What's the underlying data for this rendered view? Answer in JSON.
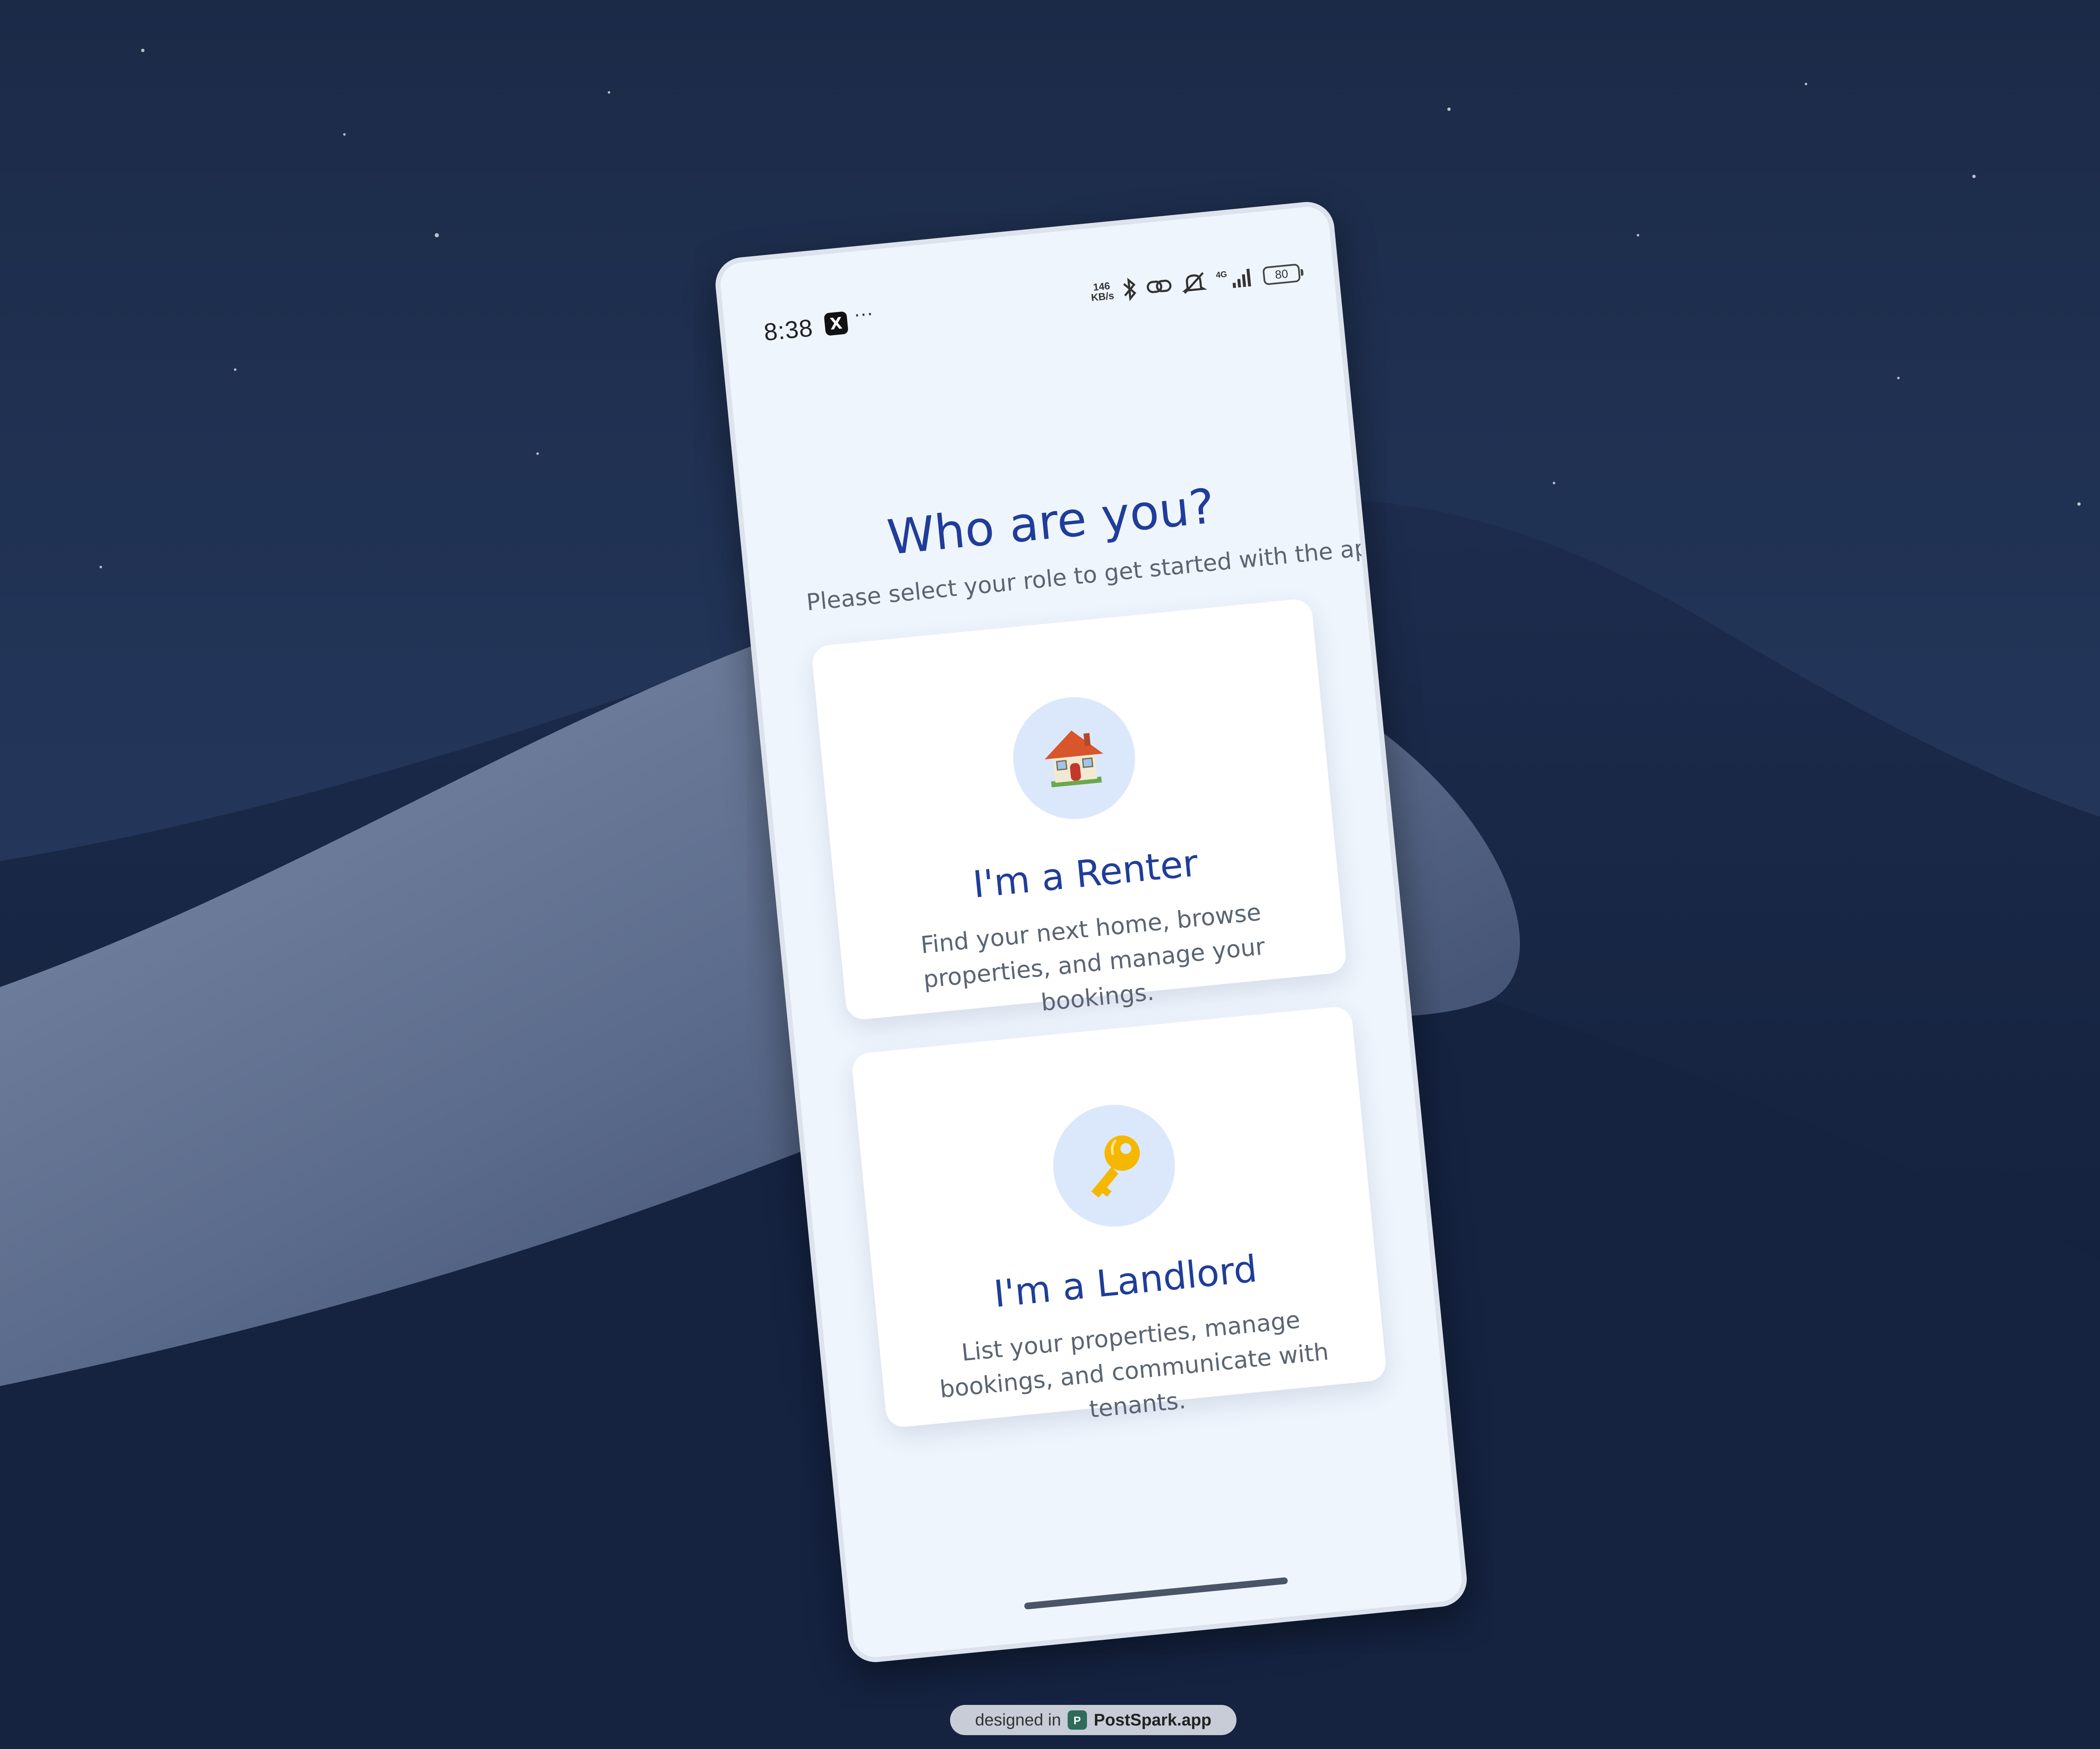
{
  "status_bar": {
    "time": "8:38",
    "x_app_glyph": "X",
    "more_glyph": "···",
    "net_speed_value": "146",
    "net_speed_unit": "KB/s",
    "network_type": "4G",
    "battery_level": "80",
    "icons": [
      "bluetooth-icon",
      "link-icon",
      "mute-icon",
      "signal-icon",
      "battery-icon"
    ]
  },
  "header": {
    "title": "Who are you?",
    "subtitle": "Please select your role to get started with the app."
  },
  "roles": [
    {
      "icon": "house-icon",
      "title": "I'm a Renter",
      "description": "Find your next home, browse properties, and manage your bookings."
    },
    {
      "icon": "key-icon",
      "title": "I'm a Landlord",
      "description": "List your properties, manage bookings, and communicate with tenants."
    }
  ],
  "watermark": {
    "prefix": "designed in",
    "brand": "PostSpark.app",
    "logo_glyph": "P"
  },
  "colors": {
    "accent": "#1f3d99",
    "screen_background": "#eff5fd",
    "card_background": "#ffffff",
    "avatar_background": "#dbe8fb",
    "body_text": "#5a6473"
  }
}
